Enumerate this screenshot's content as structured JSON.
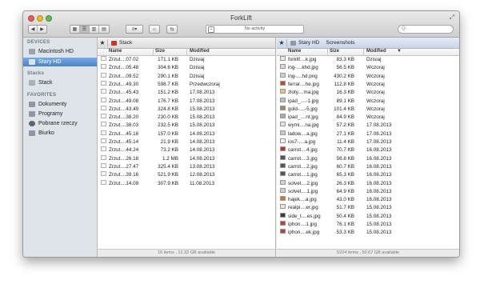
{
  "window": {
    "title": "ForkLift"
  },
  "toolbar": {
    "activity_text": "No activity",
    "search_placeholder": "Q-"
  },
  "sidebar": {
    "devices_heading": "DEVICES",
    "devices": [
      {
        "label": "Macintosh HD",
        "icon": "hard-drive-icon",
        "selected": false
      },
      {
        "label": "Stary HD",
        "icon": "hard-drive-icon",
        "selected": true
      }
    ],
    "stacks_heading": "Stacks",
    "stacks": [
      {
        "label": "Stack",
        "icon": "stack-icon"
      }
    ],
    "favorites_heading": "FAVORITES",
    "favorites": [
      {
        "label": "Dokumenty",
        "icon": "documents-icon"
      },
      {
        "label": "Programy",
        "icon": "applications-icon"
      },
      {
        "label": "Pobrane rzeczy",
        "icon": "downloads-icon"
      },
      {
        "label": "Biurko",
        "icon": "desktop-icon"
      }
    ]
  },
  "left_pane": {
    "path": [
      "Stack"
    ],
    "columns": {
      "name": "Name",
      "size": "Size",
      "modified": "Modified"
    },
    "rows": [
      {
        "name": "Zrzut....07.02",
        "size": "171.1 KB",
        "modified": "Dzisiaj"
      },
      {
        "name": "Zrzut....05.48",
        "size": "304.6 KB",
        "modified": "Dzisiaj"
      },
      {
        "name": "Zrzut....09.52",
        "size": "290.1 KB",
        "modified": "Dzisiaj"
      },
      {
        "name": "Zrzut....49.30",
        "size": "598.7 KB",
        "modified": "Przedwczoraj"
      },
      {
        "name": "Zrzut....45.43",
        "size": "151.2 KB",
        "modified": "17.08.2013"
      },
      {
        "name": "Zrzut....49.08",
        "size": "176.7 KB",
        "modified": "17.08.2013"
      },
      {
        "name": "Zrzut....43.49",
        "size": "324.8 KB",
        "modified": "15.08.2013"
      },
      {
        "name": "Zrzut....38.20",
        "size": "230.0 KB",
        "modified": "15.08.2013"
      },
      {
        "name": "Zrzut....38.03",
        "size": "232.5 KB",
        "modified": "15.08.2013"
      },
      {
        "name": "Zrzut....45.16",
        "size": "157.0 KB",
        "modified": "14.08.2013"
      },
      {
        "name": "Zrzut....45.14",
        "size": "21.9 KB",
        "modified": "14.08.2013"
      },
      {
        "name": "Zrzut....44.24",
        "size": "73.2 KB",
        "modified": "14.08.2013"
      },
      {
        "name": "Zrzut....26.18",
        "size": "1.2 MB",
        "modified": "14.08.2013"
      },
      {
        "name": "Zrzut....27.47",
        "size": "325.4 KB",
        "modified": "13.08.2013"
      },
      {
        "name": "Zrzut....39.16",
        "size": "521.9 KB",
        "modified": "12.08.2013"
      },
      {
        "name": "Zrzut....14.09",
        "size": "307.9 KB",
        "modified": "11.08.2013"
      }
    ],
    "status": "16 items , 12.32 GB available"
  },
  "right_pane": {
    "path": [
      "Stary HD",
      "Screenshots"
    ],
    "columns": {
      "name": "Name",
      "size": "Size",
      "modified": "Modified"
    },
    "rows": [
      {
        "name": "forklif....k.jpg",
        "size": "83.3 KB",
        "modified": "Dzisiaj",
        "thumb": "#e9e9e9"
      },
      {
        "name": "ing-....khd.jpg",
        "size": "56.5 KB",
        "modified": "Wczoraj",
        "thumb": "#d8d8d8"
      },
      {
        "name": "ing-....hd.png",
        "size": "430.2 KB",
        "modified": "Wczoraj",
        "thumb": "#cfcfcf"
      },
      {
        "name": "ferrar....he.jpg",
        "size": "112.8 KB",
        "modified": "Wczoraj",
        "thumb": "#b84a3a"
      },
      {
        "name": "zloty....ma.jpg",
        "size": "16.3 KB",
        "modified": "Wczoraj",
        "thumb": "#d9c48a"
      },
      {
        "name": "ipad_....-1.jpg",
        "size": "89.1 KB",
        "modified": "Wczoraj",
        "thumb": "#bdbdbd"
      },
      {
        "name": "gold-....-5.jpg",
        "size": "101.4 KB",
        "modified": "Wczoraj",
        "thumb": "#9a8a5a"
      },
      {
        "name": "ipad_....nt.jpg",
        "size": "84.9 KB",
        "modified": "Wczoraj",
        "thumb": "#aaaaaa"
      },
      {
        "name": "wymi....na.jpg",
        "size": "57.2 KB",
        "modified": "17.08.2013",
        "thumb": "#e2e2e2"
      },
      {
        "name": "ladow....a.jpg",
        "size": "27.1 KB",
        "modified": "17.08.2013",
        "thumb": "#c8c8c8"
      },
      {
        "name": "ios7-....a.jpg",
        "size": "11.4 KB",
        "modified": "17.08.2013",
        "thumb": "#eeeeee"
      },
      {
        "name": "carrot....4.jpg",
        "size": "70.7 KB",
        "modified": "16.08.2013",
        "thumb": "#b03a2e"
      },
      {
        "name": "carrot....3.jpg",
        "size": "56.8 KB",
        "modified": "16.08.2013",
        "thumb": "#555555"
      },
      {
        "name": "carrot....2.jpg",
        "size": "60.7 KB",
        "modified": "16.08.2013",
        "thumb": "#555555"
      },
      {
        "name": "carrot....1.jpg",
        "size": "65.3 KB",
        "modified": "16.08.2013",
        "thumb": "#555555"
      },
      {
        "name": "solvet....2.jpg",
        "size": "26.3 KB",
        "modified": "16.08.2013",
        "thumb": "#d0d0d0"
      },
      {
        "name": "solvet....1.jpg",
        "size": "64.9 KB",
        "modified": "16.08.2013",
        "thumb": "#d0d0d0"
      },
      {
        "name": "hajek....a.jpg",
        "size": "43.0 KB",
        "modified": "16.08.2013",
        "thumb": "#c97a3a"
      },
      {
        "name": "realpi....er.jpg",
        "size": "51.7 KB",
        "modified": "15.08.2013",
        "thumb": "#e6e6e6"
      },
      {
        "name": "side_t....es.jpg",
        "size": "50.4 KB",
        "modified": "15.08.2013",
        "thumb": "#3a3a3a"
      },
      {
        "name": "iphon....1.jpg",
        "size": "76.1 KB",
        "modified": "15.08.2013",
        "thumb": "#b8453a"
      },
      {
        "name": "iphon....ek.jpg",
        "size": "53.3 KB",
        "modified": "15.08.2013",
        "thumb": "#b8453a"
      }
    ],
    "status": "5224 items , 50.67 GB available"
  }
}
